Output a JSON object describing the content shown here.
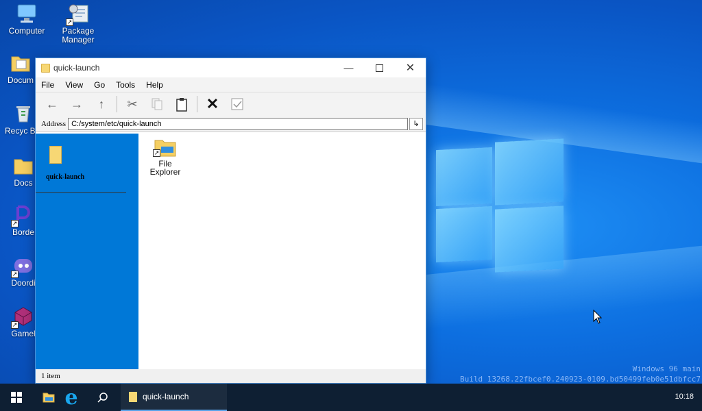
{
  "desktop": {
    "icons": [
      {
        "label": "Computer"
      },
      {
        "label": "Package Manager"
      },
      {
        "label": "Docum"
      },
      {
        "label": "Recyc Bin"
      },
      {
        "label": "Docs"
      },
      {
        "label": "Borde"
      },
      {
        "label": "Doordi"
      },
      {
        "label": "Gamel"
      }
    ]
  },
  "window": {
    "title": "quick-launch",
    "menu": [
      "File",
      "View",
      "Go",
      "Tools",
      "Help"
    ],
    "address_label": "Address",
    "address_value": "C:/system/etc/quick-launch",
    "sidebar_title": "quick-launch",
    "files": [
      {
        "label": "File Explorer"
      }
    ],
    "status": "1 item"
  },
  "watermark": {
    "line1": "Windows 96 main",
    "line2": "Build 13268.22fbcef0.240923-0109.bd50499feb0e51dbfcc7"
  },
  "taskbar": {
    "active_app": "quick-launch",
    "clock": "10:18"
  }
}
